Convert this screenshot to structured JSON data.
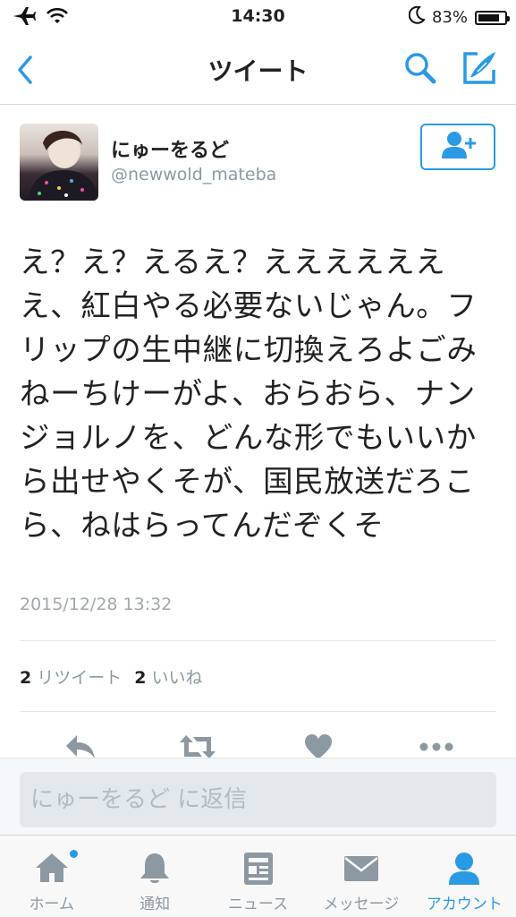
{
  "status_bar": {
    "time": "14:30",
    "battery_percent": "83%",
    "battery_level": 0.83,
    "icons": [
      "airplane-icon",
      "wifi-icon",
      "moon-icon",
      "battery-icon"
    ]
  },
  "nav": {
    "title": "ツイート",
    "icons": [
      "back-chevron-icon",
      "search-icon",
      "compose-icon"
    ]
  },
  "tweet": {
    "display_name": "にゅーをるど",
    "username": "@newwold_mateba",
    "text": "え？え？えるえ？えええええええ、紅白やる必要ないじゃん。フリップの生中継に切換えろよごみねーちけーがよ、おらおら、ナンジョルノを、どんな形でもいいから出せやくそが、国民放送だろこら、ねはらってんだぞくそ",
    "timestamp": "2015/12/28 13:32",
    "retweets_count": "2",
    "retweets_label": "リツイート",
    "likes_count": "2",
    "likes_label": "いいね"
  },
  "reply": {
    "placeholder": "にゅーをるど に返信"
  },
  "tabs": [
    {
      "label": "ホーム",
      "icon": "home-icon",
      "active": false,
      "has_dot": true
    },
    {
      "label": "通知",
      "icon": "bell-icon",
      "active": false,
      "has_dot": false
    },
    {
      "label": "ニュース",
      "icon": "news-icon",
      "active": false,
      "has_dot": false
    },
    {
      "label": "メッセージ",
      "icon": "envelope-icon",
      "active": false,
      "has_dot": false
    },
    {
      "label": "アカウント",
      "icon": "person-icon",
      "active": true,
      "has_dot": false
    }
  ],
  "colors": {
    "accent": "#2a9ae5",
    "muted": "#8899a6",
    "icon_gray": "#8c98a2"
  }
}
